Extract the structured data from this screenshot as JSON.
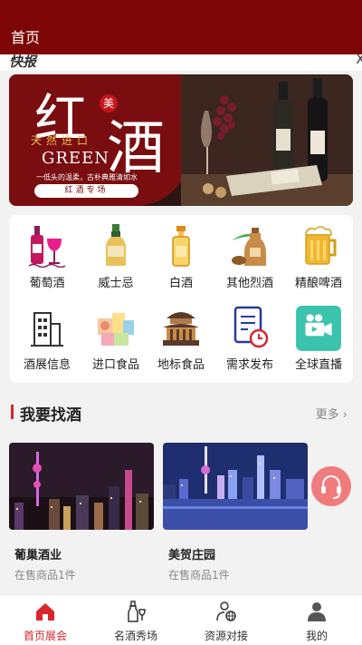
{
  "header": {
    "title": "首页"
  },
  "news": {
    "label": "快报",
    "close": "X"
  },
  "banner": {
    "char_hong": "红",
    "char_jiu": "酒",
    "badge": "美",
    "tagline": "天然进口",
    "english": "GREEN",
    "slogan": "一低头的温柔，古朴典雅清如水",
    "button": "红酒专场"
  },
  "categories": [
    {
      "label": "葡萄酒",
      "icon": "wine-bottle-glass-icon"
    },
    {
      "label": "威士忌",
      "icon": "whisky-bottle-icon"
    },
    {
      "label": "白酒",
      "icon": "baijiu-bottle-icon"
    },
    {
      "label": "其他烈酒",
      "icon": "liquor-jug-icon"
    },
    {
      "label": "精酿啤酒",
      "icon": "beer-mug-icon"
    },
    {
      "label": "酒展信息",
      "icon": "building-icon"
    },
    {
      "label": "进口食品",
      "icon": "food-boxes-icon"
    },
    {
      "label": "地标食品",
      "icon": "landmark-pavilion-icon"
    },
    {
      "label": "需求发布",
      "icon": "document-clock-icon"
    },
    {
      "label": "全球直播",
      "icon": "video-camera-icon"
    }
  ],
  "section": {
    "title": "我要找酒",
    "more": "更多"
  },
  "cards": [
    {
      "name": "葡巢酒业",
      "sub": "在售商品1件"
    },
    {
      "name": "美贺庄园",
      "sub": "在售商品1件"
    }
  ],
  "tabs": [
    {
      "label": "首页展会",
      "icon": "home-icon",
      "active": true
    },
    {
      "label": "名酒秀场",
      "icon": "wine-bottle-icon",
      "active": false
    },
    {
      "label": "资源对接",
      "icon": "user-globe-icon",
      "active": false
    },
    {
      "label": "我的",
      "icon": "user-icon",
      "active": false
    }
  ],
  "colors": {
    "brand": "#7e0506",
    "accent": "#d9262c",
    "fab": "#f07b7d"
  }
}
